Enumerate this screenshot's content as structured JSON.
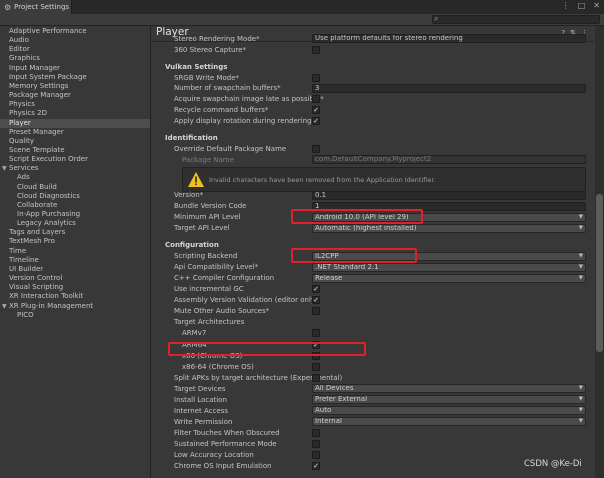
{
  "window": {
    "tab_title": "Project Settings",
    "controls": [
      "⋮",
      "□",
      "✕"
    ]
  },
  "sidebar": {
    "items": [
      {
        "label": "Adaptive Performance",
        "indent": 0
      },
      {
        "label": "Audio",
        "indent": 0
      },
      {
        "label": "Editor",
        "indent": 0
      },
      {
        "label": "Graphics",
        "indent": 0
      },
      {
        "label": "Input Manager",
        "indent": 0
      },
      {
        "label": "Input System Package",
        "indent": 0
      },
      {
        "label": "Memory Settings",
        "indent": 0
      },
      {
        "label": "Package Manager",
        "indent": 0
      },
      {
        "label": "Physics",
        "indent": 0
      },
      {
        "label": "Physics 2D",
        "indent": 0
      },
      {
        "label": "Player",
        "indent": 0,
        "selected": true
      },
      {
        "label": "Preset Manager",
        "indent": 0
      },
      {
        "label": "Quality",
        "indent": 0
      },
      {
        "label": "Scene Template",
        "indent": 0
      },
      {
        "label": "Script Execution Order",
        "indent": 0
      },
      {
        "label": "Services",
        "indent": 0,
        "expanded": true
      },
      {
        "label": "Ads",
        "indent": 1
      },
      {
        "label": "Cloud Build",
        "indent": 1
      },
      {
        "label": "Cloud Diagnostics",
        "indent": 1
      },
      {
        "label": "Collaborate",
        "indent": 1
      },
      {
        "label": "In-App Purchasing",
        "indent": 1
      },
      {
        "label": "Legacy Analytics",
        "indent": 1
      },
      {
        "label": "Tags and Layers",
        "indent": 0
      },
      {
        "label": "TextMesh Pro",
        "indent": 0
      },
      {
        "label": "Time",
        "indent": 0
      },
      {
        "label": "Timeline",
        "indent": 0
      },
      {
        "label": "UI Builder",
        "indent": 0
      },
      {
        "label": "Version Control",
        "indent": 0
      },
      {
        "label": "Visual Scripting",
        "indent": 0
      },
      {
        "label": "XR Interaction Toolkit",
        "indent": 0
      },
      {
        "label": "XR Plug-in Management",
        "indent": 0,
        "expanded": true
      },
      {
        "label": "PICO",
        "indent": 1
      }
    ]
  },
  "main": {
    "title": "Player",
    "header_icons": [
      "?",
      "⇅",
      "⋮"
    ],
    "rows": [
      {
        "label": "Stereo Rendering Mode*",
        "control": "field",
        "value": "Use platform defaults for stereo rendering"
      },
      {
        "label": "360 Stereo Capture*",
        "control": "checkbox",
        "checked": false
      },
      {
        "label": "Vulkan Settings",
        "control": "section"
      },
      {
        "label": "SRGB Write Mode*",
        "control": "checkbox",
        "checked": false
      },
      {
        "label": "Number of swapchain buffers*",
        "control": "field",
        "value": "3"
      },
      {
        "label": "Acquire swapchain image late as possible*",
        "control": "checkbox",
        "checked": false
      },
      {
        "label": "Recycle command buffers*",
        "control": "checkbox",
        "checked": true
      },
      {
        "label": "Apply display rotation during rendering",
        "control": "checkbox",
        "checked": true
      },
      {
        "label": "Identification",
        "control": "section"
      },
      {
        "label": "Override Default Package Name",
        "control": "checkbox",
        "checked": false
      },
      {
        "label": "Package Name",
        "control": "field",
        "value": "com.DefaultCompany.Myproject2",
        "dim": true,
        "sub": true
      },
      {
        "label": "",
        "control": "warning"
      },
      {
        "label": "Version*",
        "control": "field",
        "value": "0.1"
      },
      {
        "label": "Bundle Version Code",
        "control": "field",
        "value": "1"
      },
      {
        "label": "Minimum API Level",
        "control": "dropdown",
        "value": "Android 10.0 (API level 29)"
      },
      {
        "label": "Target API Level",
        "control": "dropdown",
        "value": "Automatic (highest installed)"
      },
      {
        "label": "Configuration",
        "control": "section"
      },
      {
        "label": "Scripting Backend",
        "control": "dropdown",
        "value": "IL2CPP"
      },
      {
        "label": "Api Compatibility Level*",
        "control": "dropdown",
        "value": ".NET Standard 2.1"
      },
      {
        "label": "C++ Compiler Configuration",
        "control": "dropdown",
        "value": "Release"
      },
      {
        "label": "Use incremental GC",
        "control": "checkbox",
        "checked": true
      },
      {
        "label": "Assembly Version Validation (editor only)",
        "control": "checkbox",
        "checked": true
      },
      {
        "label": "Mute Other Audio Sources*",
        "control": "checkbox",
        "checked": false
      },
      {
        "label": "Target Architectures",
        "control": "label"
      },
      {
        "label": "ARMv7",
        "control": "checkbox",
        "checked": false,
        "sub": true
      },
      {
        "label": "ARM64",
        "control": "checkbox",
        "checked": true,
        "sub": true
      },
      {
        "label": "x86 (Chrome OS)",
        "control": "checkbox",
        "checked": false,
        "sub": true
      },
      {
        "label": "x86-64 (Chrome OS)",
        "control": "checkbox",
        "checked": false,
        "sub": true
      },
      {
        "label": "Split APKs by target architecture (Experimental)",
        "control": "checkbox",
        "checked": false
      },
      {
        "label": "Target Devices",
        "control": "dropdown",
        "value": "All Devices"
      },
      {
        "label": "Install Location",
        "control": "dropdown",
        "value": "Prefer External"
      },
      {
        "label": "Internet Access",
        "control": "dropdown",
        "value": "Auto"
      },
      {
        "label": "Write Permission",
        "control": "dropdown",
        "value": "Internal"
      },
      {
        "label": "Filter Touches When Obscured",
        "control": "checkbox",
        "checked": false
      },
      {
        "label": "Sustained Performance Mode",
        "control": "checkbox",
        "checked": false
      },
      {
        "label": "Low Accuracy Location",
        "control": "checkbox",
        "checked": false
      },
      {
        "label": "Chrome OS Input Emulation",
        "control": "checkbox",
        "checked": true
      }
    ],
    "warning_text": "Invalid characters have been removed from the Application Identifier."
  },
  "watermark": "CSDN @Ke-Di",
  "colors": {
    "highlight": "#e0202a",
    "warning": "#f0c020",
    "background": "#383838"
  }
}
